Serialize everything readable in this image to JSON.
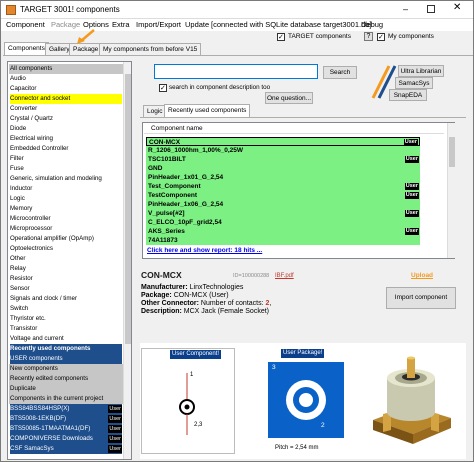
{
  "window": {
    "title": "TARGET 3001! components"
  },
  "menu": {
    "items": [
      "Component",
      "Package",
      "Options",
      "Extra",
      "Import/Export",
      "Update"
    ],
    "status": "[connected with SQLite database target3001.db]",
    "debug": "Debug"
  },
  "toolbar": {
    "target_label": "TARGET components",
    "my_label": "My components",
    "help_icon": "?"
  },
  "tabs": [
    "Components",
    "Gallery",
    "Package",
    "My components from before V15"
  ],
  "categories": [
    {
      "label": "All components",
      "style": "hdr"
    },
    {
      "label": "Audio",
      "style": ""
    },
    {
      "label": "Capacitor",
      "style": ""
    },
    {
      "label": "Connector and socket",
      "style": "sel"
    },
    {
      "label": "Converter",
      "style": ""
    },
    {
      "label": "Crystal / Quartz",
      "style": ""
    },
    {
      "label": "Diode",
      "style": ""
    },
    {
      "label": "Electrical wiring",
      "style": ""
    },
    {
      "label": "Embedded Controller",
      "style": ""
    },
    {
      "label": "Filter",
      "style": ""
    },
    {
      "label": "Fuse",
      "style": ""
    },
    {
      "label": "Generic, simulation and modeling",
      "style": ""
    },
    {
      "label": "Inductor",
      "style": ""
    },
    {
      "label": "Logic",
      "style": ""
    },
    {
      "label": "Memory",
      "style": ""
    },
    {
      "label": "Microcontroller",
      "style": ""
    },
    {
      "label": "Microprocessor",
      "style": ""
    },
    {
      "label": "Operational amplifier (OpAmp)",
      "style": ""
    },
    {
      "label": "Optoelectronics",
      "style": ""
    },
    {
      "label": "Other",
      "style": ""
    },
    {
      "label": "Relay",
      "style": ""
    },
    {
      "label": "Resistor",
      "style": ""
    },
    {
      "label": "Sensor",
      "style": ""
    },
    {
      "label": "Signals and clock / timer",
      "style": ""
    },
    {
      "label": "Switch",
      "style": ""
    },
    {
      "label": "Thyristor etc.",
      "style": ""
    },
    {
      "label": "Transistor",
      "style": ""
    },
    {
      "label": "Voltage and current",
      "style": ""
    },
    {
      "label": "Recently used components",
      "style": "section"
    },
    {
      "label": "USER components",
      "style": "blue"
    },
    {
      "label": "New components",
      "style": "hdr"
    },
    {
      "label": "Recently edited components",
      "style": "hdr"
    },
    {
      "label": "Duplicate",
      "style": "hdr"
    },
    {
      "label": "Components in the current project",
      "style": "hdr"
    },
    {
      "label": "BSS84BSS84HSP(X)",
      "style": "row2",
      "badge": "User"
    },
    {
      "label": "BTS5008-1EKB(DF)",
      "style": "row2",
      "badge": "User"
    },
    {
      "label": "BTS50085-1TMAATMA1(DF)",
      "style": "row2",
      "badge": "User"
    },
    {
      "label": "COMPONIVERSE Downloads",
      "style": "row2",
      "badge": "User"
    },
    {
      "label": "CSF SamacSys",
      "style": "row2",
      "badge": "User"
    }
  ],
  "search": {
    "value": "",
    "button": "Search",
    "desc_label": "search in component description too",
    "one_question": "One question..."
  },
  "providers": [
    "Ultra Librarian",
    "SamacSys",
    "SnapEDA"
  ],
  "subtabs": [
    "Logic",
    "Recently used components"
  ],
  "list": {
    "header": "Component name",
    "rows": [
      {
        "name": "CON-MCX",
        "badge": "User"
      },
      {
        "name": "R_1206_1000hm_1,00%_0,25W",
        "badge": ""
      },
      {
        "name": "TSC101BILT",
        "badge": "User"
      },
      {
        "name": "GND",
        "badge": ""
      },
      {
        "name": "PinHeader_1x01_G_2,54",
        "badge": ""
      },
      {
        "name": "Test_Component",
        "badge": "User"
      },
      {
        "name": "TestComponent",
        "badge": "User"
      },
      {
        "name": "PinHeader_1x06_G_2,54",
        "badge": ""
      },
      {
        "name": "V_pulse[#2]",
        "badge": "User"
      },
      {
        "name": "C_ELCO_10pF_grid2,54",
        "badge": ""
      },
      {
        "name": "AKS_Series",
        "badge": "User"
      },
      {
        "name": "74A11873",
        "badge": ""
      }
    ],
    "footer": "Click here and show report: 18 hits ..."
  },
  "detail": {
    "name": "CON-MCX",
    "id": "ID=100000288",
    "pdf": "IBF.pdf",
    "upload": "Upload",
    "manufacturer_label": "Manufacturer:",
    "manufacturer": "LinxTechnologies",
    "package_label": "Package:",
    "package": "CON-MCX (User)",
    "other_label": "Other Connector:",
    "other_prefix": "Number of contacts: ",
    "other_count": "2",
    "other_suffix": ",",
    "desc_label": "Description:",
    "desc": "MCX Jack (Female Socket)",
    "import_button": "Import component"
  },
  "symbol": {
    "label": "User Component!",
    "pin1": "1",
    "pin23": "2,3"
  },
  "pkg": {
    "label": "User Package!",
    "pin3": "3",
    "pin2": "2",
    "pitch": "Pitch = 2,54 mm"
  },
  "colors": {
    "selected": "#ffff00",
    "list_green": "#7cf082",
    "link_blue": "#0000ee",
    "pkg_blue": "#0a62c8",
    "accent_orange": "#f39a1f"
  }
}
